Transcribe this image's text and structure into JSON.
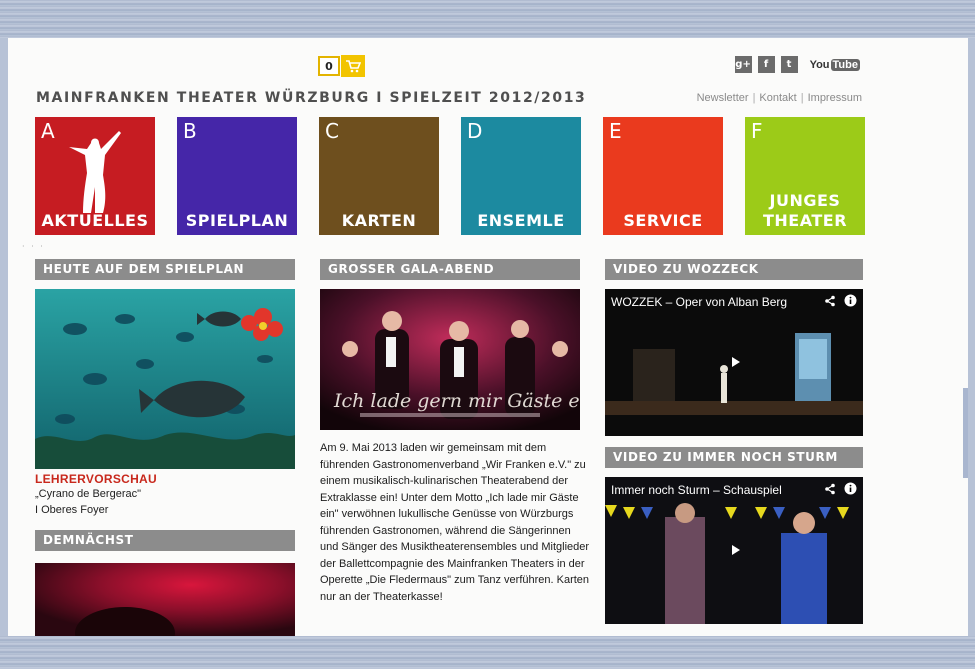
{
  "header": {
    "cart_count": "0",
    "site_title": "MAINFRANKEN THEATER WÜRZBURG  I  SPIELZEIT 2012/2013",
    "links": [
      "Newsletter",
      "Kontakt",
      "Impressum"
    ],
    "social": [
      {
        "icon": "google-plus-icon",
        "glyph": "g+"
      },
      {
        "icon": "facebook-icon",
        "glyph": "f"
      },
      {
        "icon": "twitter-icon",
        "glyph": "t"
      }
    ],
    "youtube": {
      "you": "You",
      "tube": "Tube"
    }
  },
  "tiles": [
    {
      "letter": "A",
      "label": "AKTUELLES",
      "color": "#c61c22"
    },
    {
      "letter": "B",
      "label": "SPIELPLAN",
      "color": "#4526a8"
    },
    {
      "letter": "C",
      "label": "KARTEN",
      "color": "#6e4f1e"
    },
    {
      "letter": "D",
      "label": "ENSEMLE",
      "color": "#1c8aa0"
    },
    {
      "letter": "E",
      "label": "SERVICE",
      "color": "#ea3a1e"
    },
    {
      "letter": "F",
      "label_line1": "JUNGES",
      "label_line2": "THEATER",
      "color": "#9ccb18"
    }
  ],
  "sections": {
    "heute": "HEUTE AUF DEM SPIELPLAN",
    "gala": "GROSSER GALA-ABEND",
    "video1": "VIDEO ZU WOZZECK",
    "video2": "VIDEO ZU IMMER NOCH STURM",
    "demnaechst": "DEMNÄCHST"
  },
  "lehrervorschau": {
    "title": "LEHRERVORSCHAU",
    "play": "„Cyrano de Bergerac\"",
    "location": "I Oberes Foyer"
  },
  "gala": {
    "image_caption_script": "Ich lade gern mir Gäste ein",
    "text": "Am 9. Mai 2013 laden wir gemeinsam mit dem führenden Gastronomenverband „Wir Franken e.V.\" zu einem musikalisch-kulinarischen Theaterabend der Extraklasse ein! Unter dem Motto „Ich lade mir Gäste ein\" verwöhnen lukullische Genüsse von Würzburgs führenden Gastronomen, während die Sängerinnen und Sänger des Musiktheaterensembles und Mitglieder der Ballettcompagnie des Mainfranken Theaters in der Operette „Die Fledermaus\" zum Tanz verführen. Karten nur an der Theaterkasse!"
  },
  "videos": [
    {
      "title": "WOZZEK – Oper von Alban Berg"
    },
    {
      "title": "Immer noch Sturm – Schauspiel"
    }
  ]
}
